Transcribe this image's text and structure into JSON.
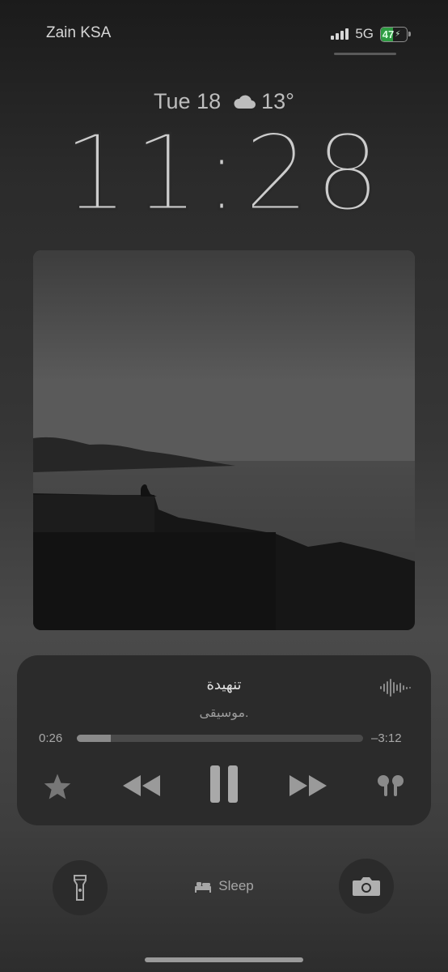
{
  "status_bar": {
    "carrier": "Zain KSA",
    "network": "5G",
    "battery_percent": "47",
    "battery_level": 0.47,
    "signal_bars": 4
  },
  "lock_screen": {
    "date": "Tue 18",
    "weather_icon": "cloud-icon",
    "temperature": "13°",
    "time": "11:28"
  },
  "now_playing": {
    "title": "تنهيدة",
    "artist": "موسيقى.",
    "elapsed": "0:26",
    "remaining": "–3:12",
    "progress": 0.12,
    "controls": {
      "favorite_icon": "star-icon",
      "previous_icon": "rewind-icon",
      "play_pause_icon": "pause-icon",
      "next_icon": "fast-forward-icon",
      "output_icon": "airpods-icon"
    }
  },
  "bottom": {
    "flashlight_icon": "flashlight-icon",
    "sleep_label": "Sleep",
    "camera_icon": "camera-icon"
  },
  "colors": {
    "battery_fill": "#2e9c42",
    "accent_text": "#cfcfcf"
  }
}
